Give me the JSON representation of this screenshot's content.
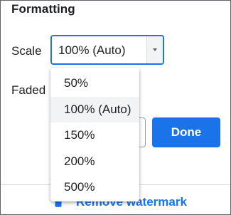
{
  "formatting": {
    "heading": "Formatting",
    "scale_label": "Scale",
    "scale_value": "100% (Auto)",
    "faded_label": "Faded"
  },
  "dropdown": {
    "options": [
      "50%",
      "100% (Auto)",
      "150%",
      "200%",
      "500%"
    ],
    "selected": "100% (Auto)"
  },
  "actions": {
    "done_label": "Done",
    "remove_watermark_label": "Remove watermark",
    "remove_watermark_icon": "trash-icon"
  },
  "colors": {
    "accent": "#1a73e8",
    "text": "#202124",
    "highlight": "#f1f3f4"
  }
}
